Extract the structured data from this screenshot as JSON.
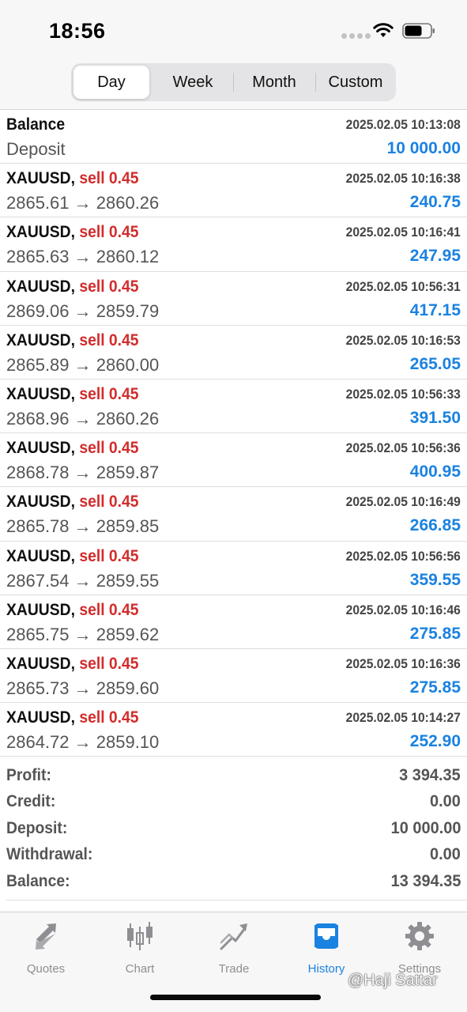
{
  "status_bar": {
    "time": "18:56",
    "icons": [
      "signal-dots-icon",
      "wifi-icon",
      "battery-icon"
    ]
  },
  "segment": {
    "selected": "Day",
    "tabs": [
      {
        "label": "Day"
      },
      {
        "label": "Week"
      },
      {
        "label": "Month"
      },
      {
        "label": "Custom"
      }
    ]
  },
  "balance_entry": {
    "title": "Balance",
    "time": "2025.02.05 10:13:08",
    "description": "Deposit",
    "amount": "10 000.00"
  },
  "deals": [
    {
      "symbol": "XAUUSD,",
      "type": "sell 0.45",
      "time": "2025.02.05 10:16:38",
      "prices": "2865.61 → 2860.26",
      "profit": "240.75"
    },
    {
      "symbol": "XAUUSD,",
      "type": "sell 0.45",
      "time": "2025.02.05 10:16:41",
      "prices": "2865.63 → 2860.12",
      "profit": "247.95"
    },
    {
      "symbol": "XAUUSD,",
      "type": "sell 0.45",
      "time": "2025.02.05 10:56:31",
      "prices": "2869.06 → 2859.79",
      "profit": "417.15"
    },
    {
      "symbol": "XAUUSD,",
      "type": "sell 0.45",
      "time": "2025.02.05 10:16:53",
      "prices": "2865.89 → 2860.00",
      "profit": "265.05"
    },
    {
      "symbol": "XAUUSD,",
      "type": "sell 0.45",
      "time": "2025.02.05 10:56:33",
      "prices": "2868.96 → 2860.26",
      "profit": "391.50"
    },
    {
      "symbol": "XAUUSD,",
      "type": "sell 0.45",
      "time": "2025.02.05 10:56:36",
      "prices": "2868.78 → 2859.87",
      "profit": "400.95"
    },
    {
      "symbol": "XAUUSD,",
      "type": "sell 0.45",
      "time": "2025.02.05 10:16:49",
      "prices": "2865.78 → 2859.85",
      "profit": "266.85"
    },
    {
      "symbol": "XAUUSD,",
      "type": "sell 0.45",
      "time": "2025.02.05 10:56:56",
      "prices": "2867.54 → 2859.55",
      "profit": "359.55"
    },
    {
      "symbol": "XAUUSD,",
      "type": "sell 0.45",
      "time": "2025.02.05 10:16:46",
      "prices": "2865.75 → 2859.62",
      "profit": "275.85"
    },
    {
      "symbol": "XAUUSD,",
      "type": "sell 0.45",
      "time": "2025.02.05 10:16:36",
      "prices": "2865.73 → 2859.60",
      "profit": "275.85"
    },
    {
      "symbol": "XAUUSD,",
      "type": "sell 0.45",
      "time": "2025.02.05 10:14:27",
      "prices": "2864.72 → 2859.10",
      "profit": "252.90"
    }
  ],
  "summary": [
    {
      "label": "Profit:",
      "value": "3 394.35"
    },
    {
      "label": "Credit:",
      "value": "0.00"
    },
    {
      "label": "Deposit:",
      "value": "10 000.00"
    },
    {
      "label": "Withdrawal:",
      "value": "0.00"
    },
    {
      "label": "Balance:",
      "value": "13 394.35"
    }
  ],
  "tab_bar": {
    "active": "History",
    "tabs": [
      {
        "label": "Quotes",
        "icon": "quotes-arrows-icon"
      },
      {
        "label": "Chart",
        "icon": "candlestick-chart-icon"
      },
      {
        "label": "Trade",
        "icon": "trade-trend-icon"
      },
      {
        "label": "History",
        "icon": "history-tray-icon"
      },
      {
        "label": "Settings",
        "icon": "gear-icon"
      }
    ]
  },
  "watermark": "@Haji Sattar",
  "colors": {
    "accent_blue": "#1a82e0",
    "sell_red": "#d22c2c",
    "muted_gray": "#555555",
    "tab_inactive": "#8e8e93"
  }
}
